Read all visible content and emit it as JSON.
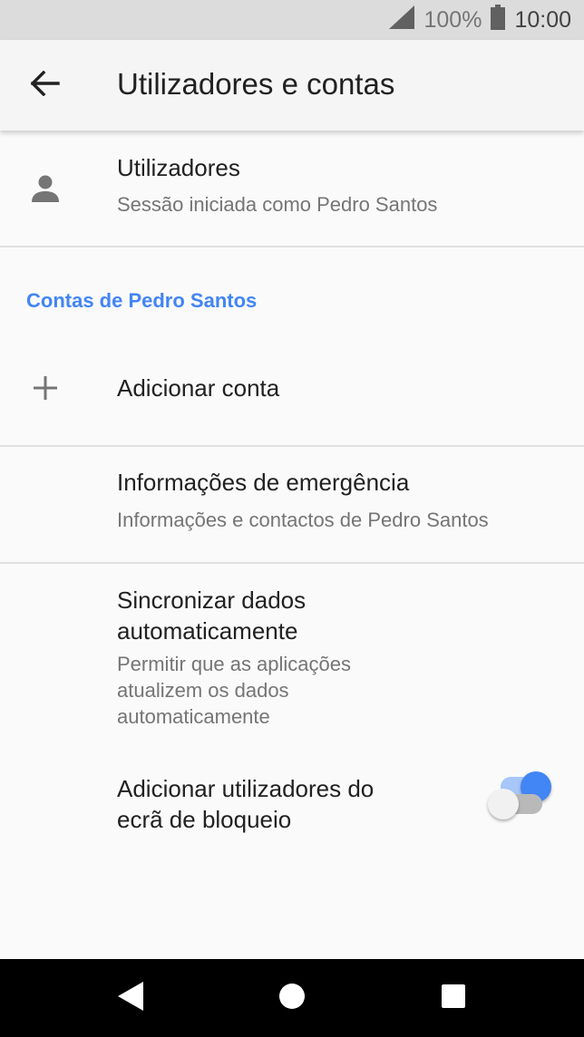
{
  "status_bar": {
    "signal_icon": "signal-icon",
    "battery_percent": "100%",
    "battery_icon": "battery-icon",
    "time": "10:00"
  },
  "app_bar": {
    "back_icon": "arrow-back-icon",
    "title": "Utilizadores e contas"
  },
  "users_row": {
    "icon": "person-icon",
    "title": "Utilizadores",
    "subtitle": "Sessão iniciada como Pedro Santos"
  },
  "accounts_section": {
    "header": "Contas de Pedro Santos",
    "add_account": {
      "icon": "plus-icon",
      "label": "Adicionar conta"
    }
  },
  "emergency_row": {
    "title": "Informações de emergência",
    "subtitle": "Informações e contactos de Pedro Santos"
  },
  "sync_row": {
    "title_line1": "Sincronizar dados",
    "title_line2": "automaticamente",
    "subtitle_line1": "Permitir que as aplicações",
    "subtitle_line2": "atualizem os dados",
    "subtitle_line3": "automaticamente",
    "enabled": true
  },
  "lockscreen_row": {
    "title_line1": "Adicionar utilizadores do",
    "title_line2": "ecrã de bloqueio",
    "enabled": false
  },
  "colors": {
    "accent": "#4285f4",
    "toggle_on_track": "#a7c6f9",
    "toggle_off_track": "#b9b9b9",
    "toggle_off_thumb": "#f1f1f1"
  },
  "nav_bar": {
    "back_icon": "nav-back-triangle-icon",
    "home_icon": "nav-home-circle-icon",
    "recents_icon": "nav-recents-square-icon"
  }
}
